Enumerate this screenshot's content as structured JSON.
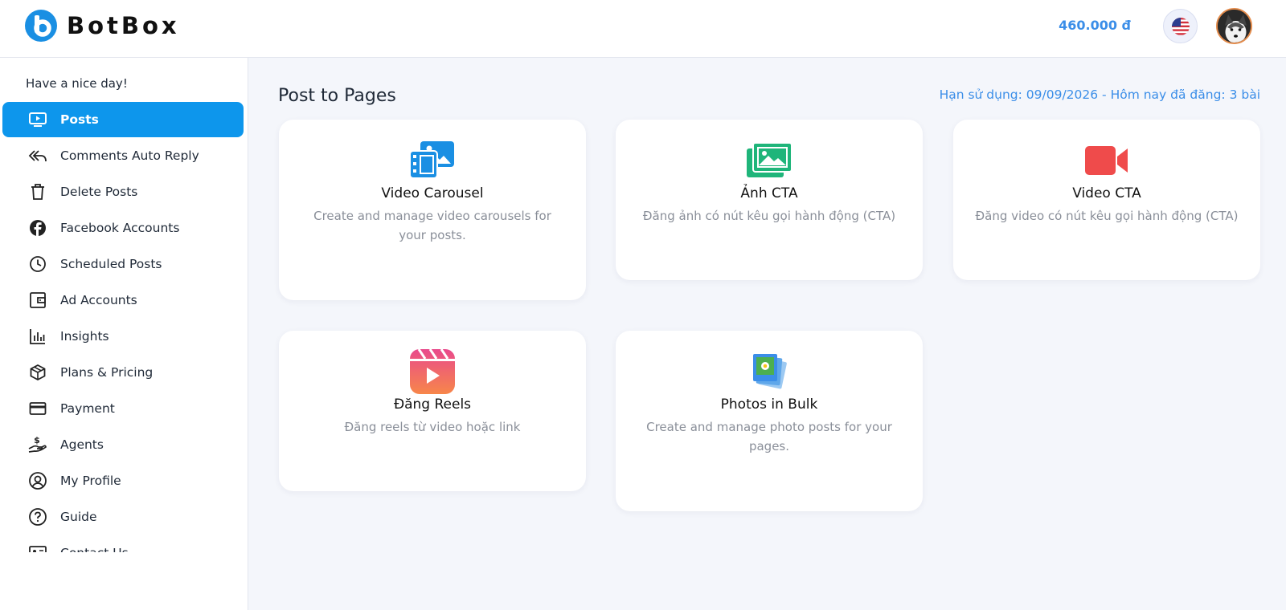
{
  "app": {
    "name": "BotBox"
  },
  "header": {
    "balance": "460.000 đ",
    "language_flag": "us-flag-icon",
    "avatar": "user-avatar"
  },
  "sidebar": {
    "greeting": "Have a nice day!",
    "items": [
      {
        "label": "Posts",
        "icon": "posts-icon",
        "active": true
      },
      {
        "label": "Comments Auto Reply",
        "icon": "reply-all-icon"
      },
      {
        "label": "Delete Posts",
        "icon": "trash-icon"
      },
      {
        "label": "Facebook Accounts",
        "icon": "facebook-icon"
      },
      {
        "label": "Scheduled Posts",
        "icon": "clock-icon"
      },
      {
        "label": "Ad Accounts",
        "icon": "wallet-icon"
      },
      {
        "label": "Insights",
        "icon": "bar-chart-icon"
      },
      {
        "label": "Plans & Pricing",
        "icon": "package-icon"
      },
      {
        "label": "Payment",
        "icon": "credit-card-icon"
      },
      {
        "label": "Agents",
        "icon": "hand-dollar-icon"
      },
      {
        "label": "My Profile",
        "icon": "user-circle-icon"
      },
      {
        "label": "Guide",
        "icon": "help-circle-icon"
      },
      {
        "label": "Contact Us",
        "icon": "contact-card-icon"
      }
    ]
  },
  "main": {
    "title": "Post to Pages",
    "expiry": "Hạn sử dụng: 09/09/2026 - Hôm nay đã đăng: 3 bài",
    "cards": [
      {
        "title": "Video Carousel",
        "desc": "Create and manage video carousels for your posts.",
        "icon": "video-carousel-icon",
        "color": "#1a8fe3"
      },
      {
        "title": "Ảnh CTA",
        "desc": "Đăng ảnh có nút kêu gọi hành động (CTA)",
        "icon": "images-icon",
        "color": "#1fb57a"
      },
      {
        "title": "Video CTA",
        "desc": "Đăng video có nút kêu gọi hành động (CTA)",
        "icon": "video-camera-icon",
        "color": "#ef4b4b"
      },
      {
        "title": "Đăng Reels",
        "desc": "Đăng reels từ video hoặc link",
        "icon": "reels-icon",
        "color": "#f0566f"
      },
      {
        "title": "Photos in Bulk",
        "desc": "Create and manage photo posts for your pages.",
        "icon": "photos-bulk-icon",
        "color": "#3b8ee8"
      }
    ]
  }
}
